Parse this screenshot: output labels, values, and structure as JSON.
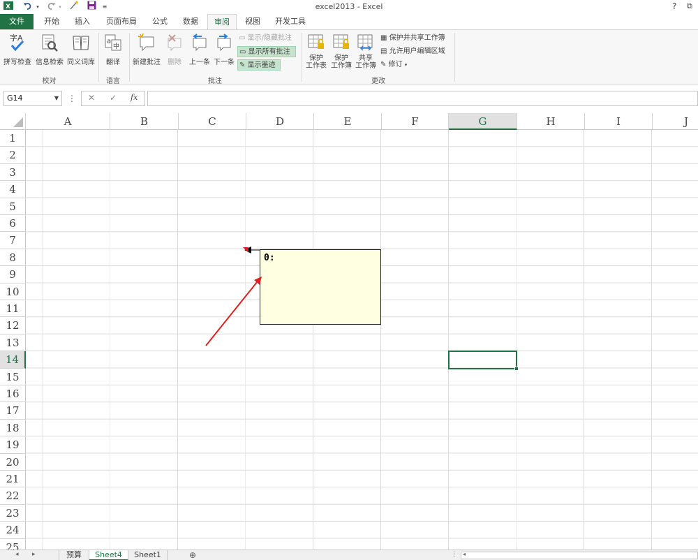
{
  "titlebar": {
    "title": "excel2013 - Excel",
    "help": "?",
    "restore": "⧉"
  },
  "tabs": [
    "文件",
    "开始",
    "插入",
    "页面布局",
    "公式",
    "数据",
    "审阅",
    "视图",
    "开发工具"
  ],
  "ribbon": {
    "proofing": {
      "spell": "拼写检查",
      "research": "信息检索",
      "thesaurus": "同义词库",
      "group": "校对"
    },
    "language": {
      "translate": "翻译",
      "group": "语言"
    },
    "comments": {
      "new": "新建批注",
      "delete": "删除",
      "prev": "上一条",
      "next": "下一条",
      "show_hide": "显示/隐藏批注",
      "show_all": "显示所有批注",
      "show_ink": "显示墨迹",
      "group": "批注"
    },
    "changes": {
      "protect_sheet_1": "保护",
      "protect_sheet_2": "工作表",
      "protect_book_1": "保护",
      "protect_book_2": "工作簿",
      "share_1": "共享",
      "share_2": "工作簿",
      "protect_share": "保护并共享工作簿",
      "allow_edit": "允许用户编辑区域",
      "track": "修订",
      "group": "更改"
    }
  },
  "formula_bar": {
    "name_box": "G14",
    "fx": "fx",
    "value": ""
  },
  "columns": [
    "A",
    "B",
    "C",
    "D",
    "E",
    "F",
    "G",
    "H",
    "I",
    "J"
  ],
  "rows": [
    "1",
    "2",
    "3",
    "4",
    "5",
    "6",
    "7",
    "8",
    "9",
    "10",
    "11",
    "12",
    "13",
    "14",
    "15",
    "16",
    "17",
    "18",
    "19",
    "20",
    "21",
    "22",
    "23",
    "24",
    "25"
  ],
  "selected": {
    "column": "G",
    "row": "14"
  },
  "comment": {
    "text": "0:"
  },
  "sheets": [
    "预算",
    "Sheet4",
    "Sheet1"
  ],
  "active_sheet": "Sheet4",
  "colors": {
    "accent": "#217346",
    "comment_fill": "#ffffe1",
    "annotation": "#e02020"
  }
}
